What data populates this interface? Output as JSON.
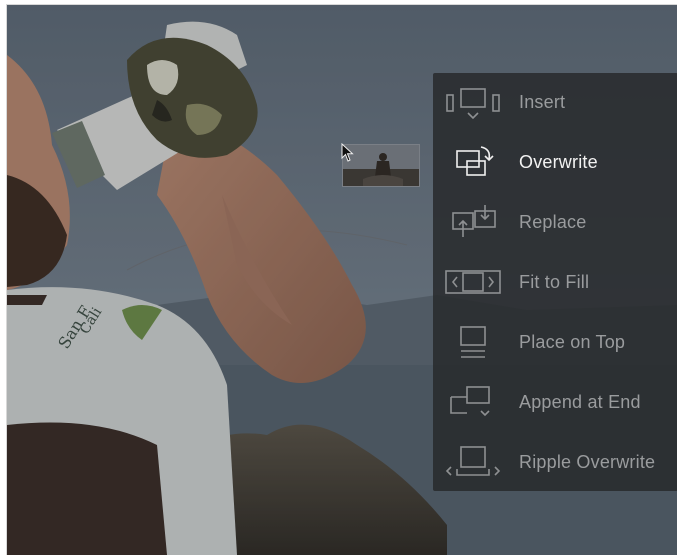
{
  "overlay": {
    "options": [
      {
        "label": "Insert",
        "icon": "insert-edit-icon",
        "active": false
      },
      {
        "label": "Overwrite",
        "icon": "overwrite-edit-icon",
        "active": true
      },
      {
        "label": "Replace",
        "icon": "replace-edit-icon",
        "active": false
      },
      {
        "label": "Fit to Fill",
        "icon": "fit-to-fill-icon",
        "active": false
      },
      {
        "label": "Place on Top",
        "icon": "place-on-top-icon",
        "active": false
      },
      {
        "label": "Append at End",
        "icon": "append-at-end-icon",
        "active": false
      },
      {
        "label": "Ripple Overwrite",
        "icon": "ripple-overwrite-icon",
        "active": false
      }
    ]
  },
  "colors": {
    "overlay_bg": "#2a2c2e",
    "active_text": "#f2f2f2",
    "inactive_text": "#9a9c9e"
  }
}
